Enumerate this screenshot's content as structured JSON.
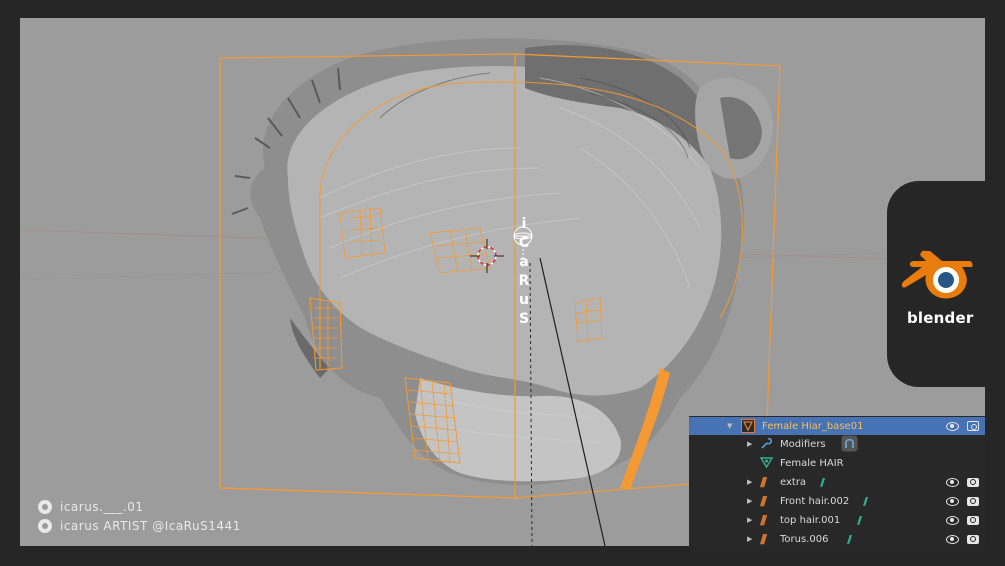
{
  "watermark": {
    "letters": [
      "i",
      "C",
      "a",
      "R",
      "u",
      "S"
    ]
  },
  "social": {
    "instagram": "icarus.___.01",
    "pinterest": "icarus ARTIST @IcaRuS1441"
  },
  "logo": {
    "text": "blender",
    "colors": {
      "orange": "#e87d0d",
      "blue": "#265787",
      "white": "#ffffff"
    }
  },
  "outliner": {
    "rows": [
      {
        "label": "Female Hiar_base01",
        "selected": true,
        "icon": "mesh-triangle-icon"
      },
      {
        "label": "Modifiers",
        "icon": "wrench-icon"
      },
      {
        "label": "Female HAIR",
        "icon": "vertex-group-icon"
      },
      {
        "label": "extra",
        "icon": "hair-particles-icon"
      },
      {
        "label": "Front hair.002",
        "icon": "hair-particles-icon"
      },
      {
        "label": "top hair.001",
        "icon": "hair-particles-icon"
      },
      {
        "label": "Torus.006",
        "icon": "hair-particles-icon"
      }
    ]
  },
  "colors": {
    "viewport_bg": "#9c9c9c",
    "selection_orange": "#f59a32",
    "outliner_bg": "#282828",
    "selected_row": "#4772b3"
  }
}
